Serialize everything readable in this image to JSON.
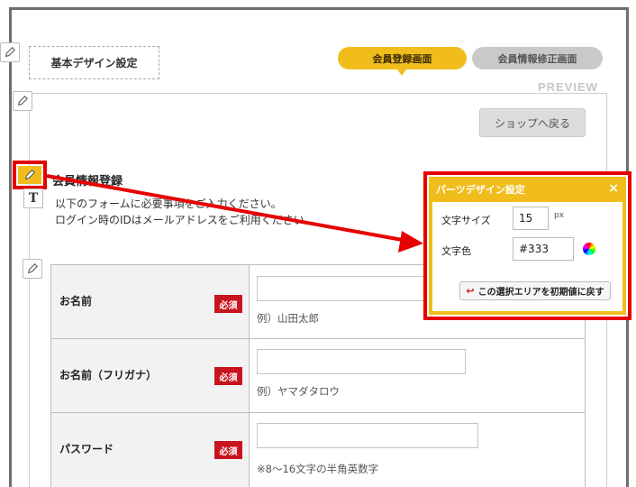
{
  "design_settings": {
    "label": "基本デザイン設定"
  },
  "tabs": [
    {
      "label": "会員登録画面",
      "active": true
    },
    {
      "label": "会員情報修正画面",
      "active": false
    }
  ],
  "preview_label": "PREVIEW",
  "shop_back_button": "ショップへ戻る",
  "section": {
    "title": "会員情報登録",
    "intro_line1": "以下のフォームに必要事項をご入力ください。",
    "intro_line2": "ログイン時のIDはメールアドレスをご利用ください。"
  },
  "form": {
    "required_badge": "必須",
    "rows": [
      {
        "label": "お名前",
        "hint": "例）山田太郎"
      },
      {
        "label": "お名前（フリガナ）",
        "hint": "例）ヤマダタロウ"
      },
      {
        "label": "パスワード",
        "hint": "※8〜16文字の半角英数字"
      }
    ]
  },
  "popup": {
    "title": "パーツデザイン設定",
    "close": "×",
    "font_size_label": "文字サイズ",
    "font_size_value": "15",
    "font_size_unit": "px",
    "color_label": "文字色",
    "color_value": "#333",
    "reset_button": "この選択エリアを初期値に戻す"
  },
  "colors": {
    "accent": "#f0bd1c",
    "highlight": "#e60000",
    "required": "#c8141e"
  }
}
